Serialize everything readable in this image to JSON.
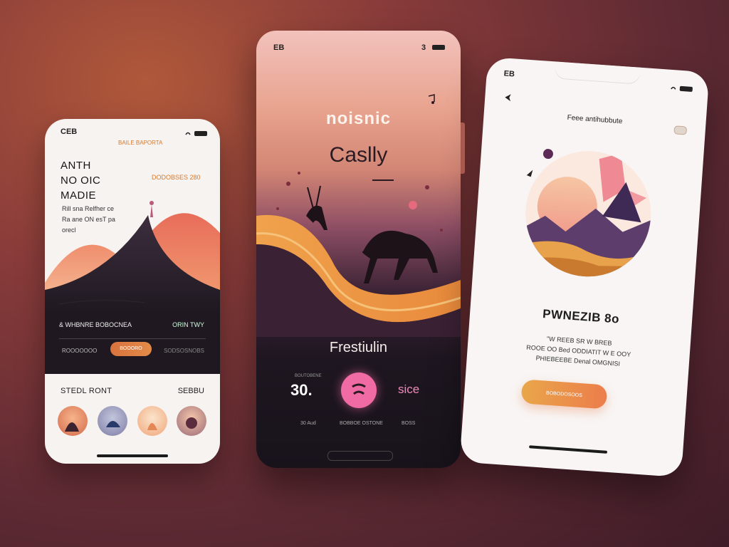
{
  "left_phone": {
    "status_time": "CEB",
    "accent_text": "BAILE BAPORTA",
    "title_lines": [
      "ANTH",
      "NO OIC",
      "MADIE"
    ],
    "price_text": "DODOBSES 280",
    "subtitle_lines": [
      "Rill sna Relfher ce",
      "Ra ane ON esT pa",
      "orecl"
    ],
    "dark_row_left": "& WHBNRE BOBOCNEA",
    "dark_row_right": "ORIN  TWY",
    "dark_label_left": "ROOOOOOO",
    "dark_button": "BOOORO",
    "dark_label_right": "SODSOSNOBS",
    "section_left": "STEDL RONT",
    "section_right": "SEBBU"
  },
  "middle_phone": {
    "status_time": "EB",
    "status_right": "3",
    "brand": "noisnic",
    "title": "Caslly",
    "name": "Frestiulin",
    "count_label": "BOUTOBENE",
    "count": "30.",
    "see_label": "sice",
    "footer": [
      "30 Aud",
      "BOBBOE OSTONE",
      "BOSS"
    ]
  },
  "right_phone": {
    "status_time": "EB",
    "header": "Feee antihubbute",
    "title": "PWNEZIB 8o",
    "body_lines": [
      "\"W REEB SR W BREB",
      "ROOE OO Bed ODDIATIT W E OOY",
      "PHIEBEEBE Denal OMGNISI"
    ],
    "button": "BOBODOSOOS"
  },
  "colors": {
    "accent_orange": "#e07a3e",
    "accent_pink": "#f06aa4",
    "dark_panel": "#1f1820"
  }
}
